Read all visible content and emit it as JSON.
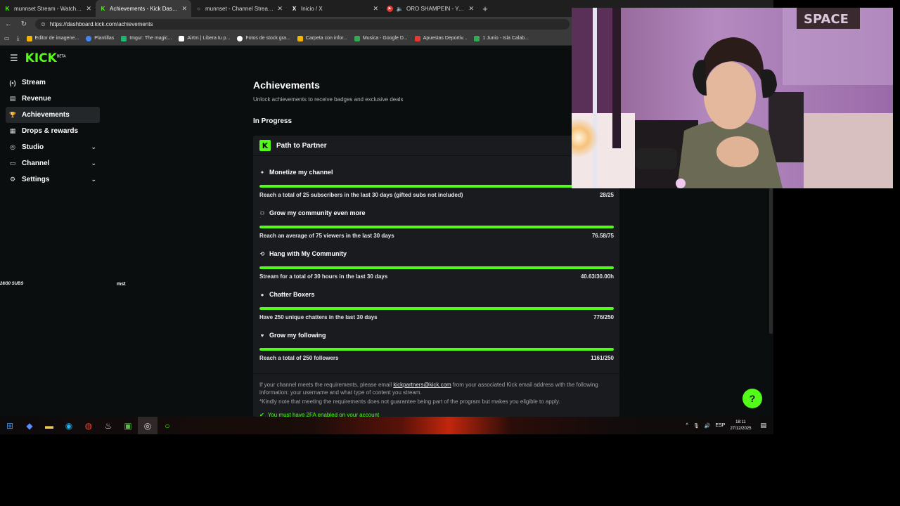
{
  "browser": {
    "tabs": [
      {
        "title": "munnset Stream - Watch Live on Kick",
        "favicon": "K",
        "active": false
      },
      {
        "title": "Achievements - Kick Dashboard",
        "favicon": "K",
        "active": true
      },
      {
        "title": "munnset - Channel Streams on Kick",
        "favicon": "○",
        "active": false
      },
      {
        "title": "Inicio / X",
        "favicon": "X",
        "active": false
      },
      {
        "title": "ORO SHAMPEIN - YouTube Music",
        "favicon": "▶",
        "active": false
      }
    ],
    "new_tab": "+",
    "url": "https://dashboard.kick.com/achievements",
    "bookmarks": [
      {
        "label": "Editor de imagene...",
        "color": "#f4b400"
      },
      {
        "label": "Plantillas",
        "color": "#4285f4"
      },
      {
        "label": "Imgur: The magic...",
        "color": "#1bb76e"
      },
      {
        "label": "Airtm | Libera tu p...",
        "color": "#ffffff"
      },
      {
        "label": "Fotos de stock gra...",
        "color": "#ffffff"
      },
      {
        "label": "Carpeta con infor...",
        "color": "#f4b400"
      },
      {
        "label": "Musica - Google D...",
        "color": "#34a853"
      },
      {
        "label": "Apuestas Deportiv...",
        "color": "#e53935"
      },
      {
        "label": "1 Junio - Isla Calab...",
        "color": "#34a853"
      }
    ]
  },
  "app": {
    "logo": "KICK",
    "logo_tag": "BETA"
  },
  "sidebar": {
    "items": [
      {
        "label": "Stream",
        "icon": "(•)",
        "has_chevron": false,
        "active": false
      },
      {
        "label": "Revenue",
        "icon": "▤",
        "has_chevron": false,
        "active": false
      },
      {
        "label": "Achievements",
        "icon": "🏆",
        "has_chevron": false,
        "active": true
      },
      {
        "label": "Drops & rewards",
        "icon": "▦",
        "has_chevron": false,
        "active": false
      },
      {
        "label": "Studio",
        "icon": "◎",
        "has_chevron": true,
        "active": false
      },
      {
        "label": "Channel",
        "icon": "▭",
        "has_chevron": true,
        "active": false
      },
      {
        "label": "Settings",
        "icon": "⚙",
        "has_chevron": true,
        "active": false
      }
    ],
    "chevron": "⌄"
  },
  "overlay": {
    "subs": "28/30 SUBS",
    "mst": "mst"
  },
  "main": {
    "title": "Achievements",
    "subtitle": "Unlock achievements to receive badges and exclusive deals",
    "section": "In Progress",
    "card_title": "Path to Partner",
    "card_badge": "K",
    "achievements": [
      {
        "title": "Monetize my channel",
        "icon": "✦",
        "desc": "Reach a total of 25 subscribers in the last 30 days (gifted subs not included)",
        "progress_text": "28/25",
        "progress": 1.0
      },
      {
        "title": "Grow my community even more",
        "icon": "⚇",
        "desc": "Reach an average of 75 viewers in the last 30 days",
        "progress_text": "76.58/75",
        "progress": 1.0
      },
      {
        "title": "Hang with My Community",
        "icon": "⟲",
        "desc": "Stream for a total of 30 hours in the last 30 days",
        "progress_text": "40.63/30.00h",
        "progress": 1.0
      },
      {
        "title": "Chatter Boxers",
        "icon": "●",
        "desc": "Have 250 unique chatters in the last 30 days",
        "progress_text": "776/250",
        "progress": 1.0
      },
      {
        "title": "Grow my following",
        "icon": "♥",
        "desc": "Reach a total of 250 followers",
        "progress_text": "1161/250",
        "progress": 1.0
      }
    ],
    "footer": {
      "p1_before": "If your channel meets the requirements, please email ",
      "email": "kickpartners@kick.com",
      "p1_after": " from your associated Kick email address with the following information: your username and what type of content you stream.",
      "p2": "*Kindly note that meeting the requirements does not guarantee being part of the program but makes you eligible to apply.",
      "p3": "You must have 2FA enabled on your account"
    }
  },
  "taskbar": {
    "icons": [
      {
        "name": "windows-start",
        "glyph": "⊞",
        "color": "#3a8ee6"
      },
      {
        "name": "copilot",
        "glyph": "◆",
        "color": "#5b8cff"
      },
      {
        "name": "file-explorer",
        "glyph": "▬",
        "color": "#f2c94c"
      },
      {
        "name": "edge",
        "glyph": "◉",
        "color": "#1faee9"
      },
      {
        "name": "chrome",
        "glyph": "◍",
        "color": "#e84335"
      },
      {
        "name": "steam",
        "glyph": "♨",
        "color": "#c6d4df"
      },
      {
        "name": "minecraft",
        "glyph": "▣",
        "color": "#5dbb4a"
      },
      {
        "name": "obs",
        "glyph": "◎",
        "color": "#dddddd"
      },
      {
        "name": "kick-app",
        "glyph": "○",
        "color": "#53fc18"
      }
    ],
    "tray": {
      "chevron": "^",
      "mic": "🎙",
      "volume": "🔊",
      "lang": "ESP",
      "time": "18:11",
      "date": "27/12/2025",
      "notif": "▤"
    }
  },
  "help_button": "?"
}
